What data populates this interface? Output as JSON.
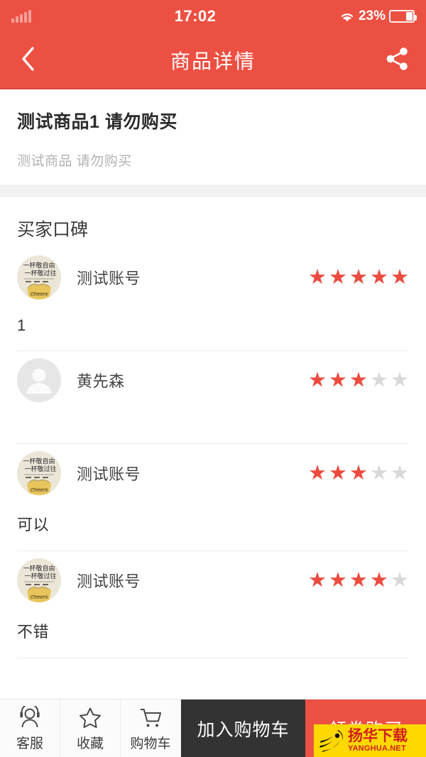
{
  "status_bar": {
    "time": "17:02",
    "battery_percent": "23%",
    "signal_icon": "signal-bars-icon",
    "wifi_icon": "wifi-icon",
    "battery_icon": "battery-icon"
  },
  "nav": {
    "title": "商品详情",
    "back_icon": "back-chevron-icon",
    "share_icon": "share-icon"
  },
  "product": {
    "title": "测试商品1 请勿购买",
    "subtitle": "测试商品 请勿购买"
  },
  "reviews": {
    "section_title": "买家口碑",
    "items": [
      {
        "name": "测试账号",
        "avatar": "beer-avatar",
        "rating": 5,
        "text": "1"
      },
      {
        "name": "黄先森",
        "avatar": "default-avatar",
        "rating": 3,
        "text": ""
      },
      {
        "name": "测试账号",
        "avatar": "beer-avatar",
        "rating": 3,
        "text": "可以"
      },
      {
        "name": "测试账号",
        "avatar": "beer-avatar",
        "rating": 4,
        "text": "不错"
      }
    ]
  },
  "avatar_art": {
    "line1": "一杯敬自由",
    "line2": "一杯敬过往"
  },
  "bottom_bar": {
    "service_label": "客服",
    "service_icon": "headset-support-icon",
    "favorite_label": "收藏",
    "favorite_icon": "star-outline-icon",
    "cart_label": "购物车",
    "cart_icon": "shopping-cart-icon",
    "add_to_cart_label": "加入购物车",
    "buy_label": "领券购买"
  },
  "watermark": {
    "main": "扬华下载",
    "sub": "YANGHUA.NET",
    "logo_icon": "tiger-flame-logo-icon"
  },
  "colors": {
    "brand_red": "#ec5043",
    "star_active": "#ec4b3f",
    "star_inactive": "#d9d9d9",
    "dark_button": "#333333",
    "watermark_bg": "#ffd800"
  }
}
